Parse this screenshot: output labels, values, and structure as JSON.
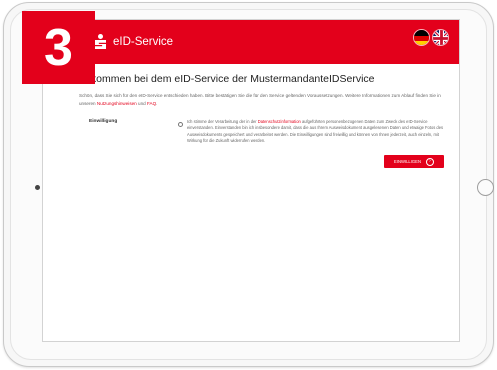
{
  "step": {
    "number": "3"
  },
  "header": {
    "brand": "eID-Service",
    "languages": [
      {
        "code": "de",
        "icon": "german-flag-icon"
      },
      {
        "code": "en",
        "icon": "uk-flag-icon"
      }
    ]
  },
  "colors": {
    "accent": "#e3001b"
  },
  "main": {
    "heading": "Willkommen bei dem eID-Service der MustermandanteIDService",
    "intro_before": "Schön, dass Sie sich für den eID-Service entschieden haben. Bitte bestätigen Sie die für den Service geltenden Voraussetzungen. Weitere Informationen zum Ablauf finden Sie in unseren",
    "intro_link1": "Nutzungshinweisen",
    "intro_and": "und",
    "intro_link2": "FAQ",
    "consent_label": "Einwilligung",
    "consent_before": "Ich stimme der Verarbeitung der in der",
    "consent_link": "Datenschutzinformation",
    "consent_after": "aufgeführten personenbezogenen Daten zum Zweck des eID-Service einverstanden. Einverstanden bin ich insbesondere damit, dass die aus Ihrem Ausweisdokument ausgelesenen Daten und etwaige Fotos des Ausweisdokuments gespeichert und verarbeitet werden. Die Einwilligungen sind freiwillig und können von Ihnen jederzeit, auch einzeln, mit Wirkung für die Zukunft widerrufen werden.",
    "submit_label": "EINWILLIGEN",
    "submit_icon": "chevron-right-circle-icon"
  }
}
